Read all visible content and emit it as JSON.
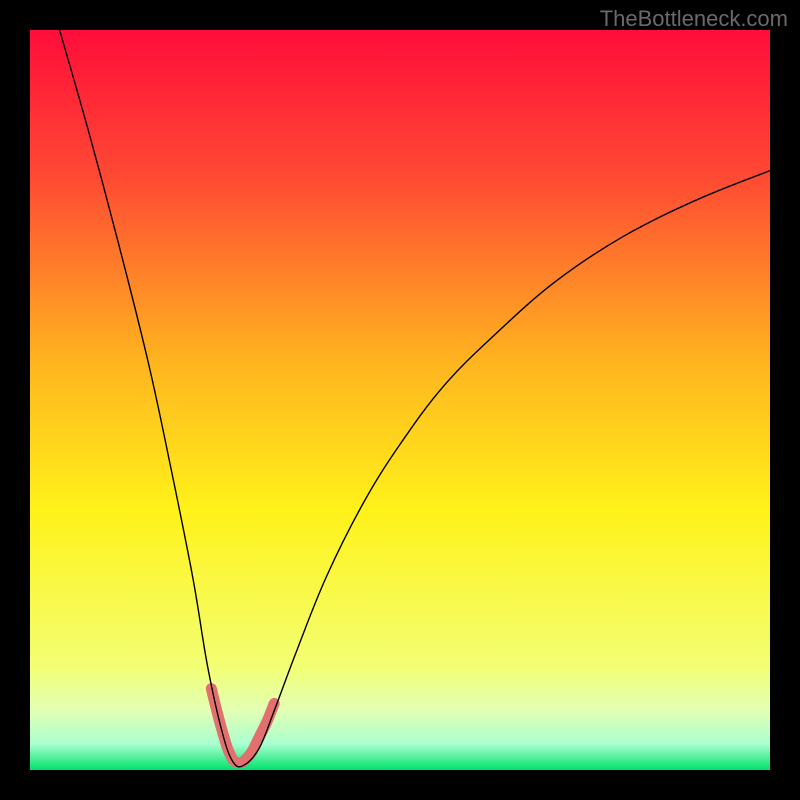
{
  "watermark": "TheBottleneck.com",
  "chart_data": {
    "type": "line",
    "title": "",
    "xlabel": "",
    "ylabel": "",
    "xlim": [
      0,
      100
    ],
    "ylim": [
      0,
      100
    ],
    "background": {
      "type": "vertical-gradient",
      "stops": [
        {
          "offset": 0.0,
          "color": "#ff0d3a"
        },
        {
          "offset": 0.2,
          "color": "#ff4a33"
        },
        {
          "offset": 0.45,
          "color": "#ffb51f"
        },
        {
          "offset": 0.65,
          "color": "#fff21a"
        },
        {
          "offset": 0.86,
          "color": "#f3ff73"
        },
        {
          "offset": 0.92,
          "color": "#e2ffb5"
        },
        {
          "offset": 0.965,
          "color": "#aaffcf"
        },
        {
          "offset": 1.0,
          "color": "#00e26b"
        }
      ]
    },
    "series": [
      {
        "name": "bottleneck-curve",
        "color": "#000000",
        "stroke_width": 1.4,
        "x": [
          4.0,
          8,
          12,
          16,
          19,
          22,
          24,
          26,
          27.5,
          29,
          31,
          33,
          36,
          40,
          45,
          50,
          56,
          63,
          71,
          80,
          90,
          100
        ],
        "values": [
          100,
          86,
          71,
          55,
          41,
          26,
          14,
          5,
          1,
          0.7,
          3,
          8,
          16,
          26,
          36,
          44,
          52,
          59,
          66,
          72,
          77,
          81
        ]
      },
      {
        "name": "highlight-band",
        "color": "#e2706f",
        "stroke_width": 11,
        "x": [
          24.5,
          25.5,
          26.5,
          27.0,
          27.5,
          28.0,
          28.5,
          29.0,
          30.0,
          31.0,
          32.0,
          33.0
        ],
        "values": [
          11,
          7,
          3.5,
          2.2,
          1.3,
          1.0,
          1.0,
          1.3,
          2.5,
          4.5,
          6.5,
          9
        ]
      }
    ]
  }
}
